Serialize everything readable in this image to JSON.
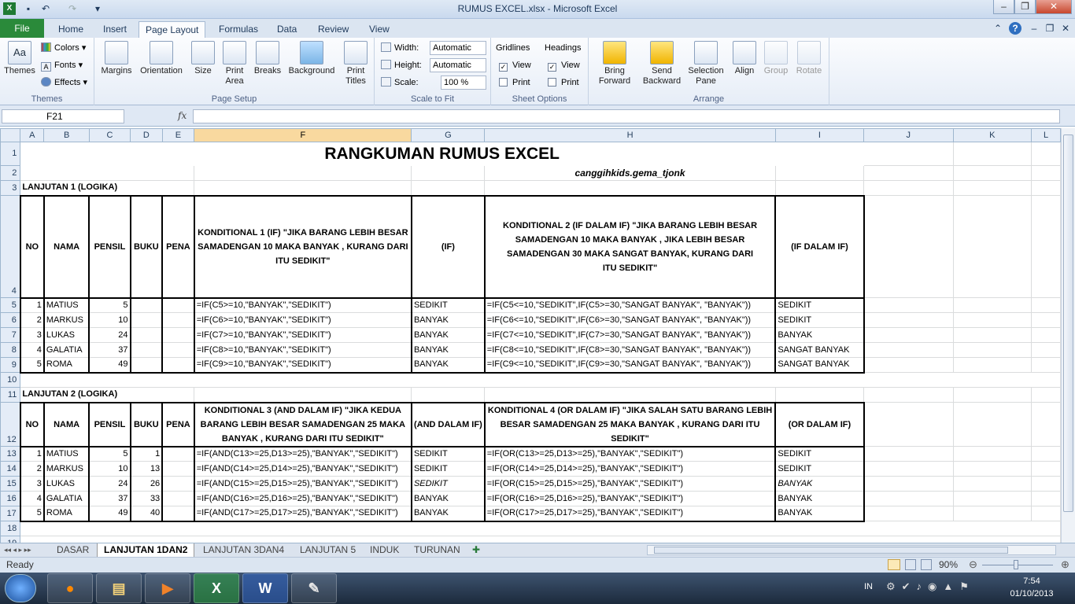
{
  "window": {
    "title": "RUMUS EXCEL.xlsx - Microsoft Excel",
    "controls": [
      "–",
      "❐",
      "✕"
    ]
  },
  "tabs": [
    "File",
    "Home",
    "Insert",
    "Page Layout",
    "Formulas",
    "Data",
    "Review",
    "View"
  ],
  "ribbon": {
    "themes": {
      "themes": "Themes",
      "colors": "Colors",
      "fonts": "Fonts",
      "effects": "Effects",
      "label": "Themes"
    },
    "page_setup": {
      "margins": "Margins",
      "orientation": "Orientation",
      "size": "Size",
      "print_area": "Print Area",
      "breaks": "Breaks",
      "background": "Background",
      "print_titles": "Print Titles",
      "label": "Page Setup"
    },
    "scale": {
      "width_label": "Width:",
      "width_value": "Automatic",
      "height_label": "Height:",
      "height_value": "Automatic",
      "scale_label": "Scale:",
      "scale_value": "100 %",
      "label": "Scale to Fit"
    },
    "sheet_options": {
      "gridlines": "Gridlines",
      "headings": "Headings",
      "view": "View",
      "print": "Print",
      "label": "Sheet Options"
    },
    "arrange": {
      "bring_forward": "Bring Forward",
      "send_backward": "Send Backward",
      "selection_pane": "Selection Pane",
      "align": "Align",
      "group": "Group",
      "rotate": "Rotate",
      "label": "Arrange"
    }
  },
  "formula_bar": {
    "name_box": "F21",
    "fx": "fx",
    "value": ""
  },
  "columns": [
    "A",
    "B",
    "C",
    "D",
    "E",
    "F",
    "G",
    "H",
    "I",
    "J",
    "K",
    "L"
  ],
  "sheet": {
    "title": "RANGKUMAN RUMUS EXCEL",
    "subtitle": "canggihkids.gema_tjonk",
    "section1": "LANJUTAN 1 (LOGIKA)",
    "section2": "LANJUTAN 2 (LOGIKA)",
    "headers1": [
      "NO",
      "NAMA",
      "PENSIL",
      "BUKU",
      "PENA",
      "KONDITIONAL 1 (IF) \"JIKA BARANG LEBIH BESAR SAMADENGAN 10 MAKA BANYAK , KURANG DARI ITU SEDIKIT\"",
      "(IF)",
      "KONDITIONAL 2 (IF DALAM IF) \"JIKA BARANG LEBIH BESAR SAMADENGAN 10 MAKA BANYAK , JIKA LEBIH BESAR SAMADENGAN 30 MAKA SANGAT BANYAK, KURANG DARI ITU SEDIKIT\"",
      "(IF DALAM IF)"
    ],
    "rows1": [
      [
        "1",
        "MATIUS",
        "5",
        "",
        "",
        "=IF(C5>=10,\"BANYAK\",\"SEDIKIT\")",
        "SEDIKIT",
        "=IF(C5<=10,\"SEDIKIT\",IF(C5>=30,\"SANGAT BANYAK\", \"BANYAK\"))",
        "SEDIKIT"
      ],
      [
        "2",
        "MARKUS",
        "10",
        "",
        "",
        "=IF(C6>=10,\"BANYAK\",\"SEDIKIT\")",
        "BANYAK",
        "=IF(C6<=10,\"SEDIKIT\",IF(C6>=30,\"SANGAT BANYAK\", \"BANYAK\"))",
        "SEDIKIT"
      ],
      [
        "3",
        "LUKAS",
        "24",
        "",
        "",
        "=IF(C7>=10,\"BANYAK\",\"SEDIKIT\")",
        "BANYAK",
        "=IF(C7<=10,\"SEDIKIT\",IF(C7>=30,\"SANGAT BANYAK\", \"BANYAK\"))",
        "BANYAK"
      ],
      [
        "4",
        "GALATIA",
        "37",
        "",
        "",
        "=IF(C8>=10,\"BANYAK\",\"SEDIKIT\")",
        "BANYAK",
        "=IF(C8<=10,\"SEDIKIT\",IF(C8>=30,\"SANGAT BANYAK\", \"BANYAK\"))",
        "SANGAT BANYAK"
      ],
      [
        "5",
        "ROMA",
        "49",
        "",
        "",
        "=IF(C9>=10,\"BANYAK\",\"SEDIKIT\")",
        "BANYAK",
        "=IF(C9<=10,\"SEDIKIT\",IF(C9>=30,\"SANGAT BANYAK\", \"BANYAK\"))",
        "SANGAT BANYAK"
      ]
    ],
    "headers2": [
      "NO",
      "NAMA",
      "PENSIL",
      "BUKU",
      "PENA",
      "KONDITIONAL 3 (AND DALAM IF) \"JIKA KEDUA BARANG LEBIH BESAR SAMADENGAN 25 MAKA BANYAK , KURANG DARI ITU SEDIKIT\"",
      "(AND DALAM IF)",
      "KONDITIONAL 4 (OR DALAM IF) \"JIKA SALAH SATU BARANG LEBIH BESAR SAMADENGAN 25 MAKA BANYAK , KURANG DARI ITU SEDIKIT\"",
      "(OR DALAM IF)"
    ],
    "rows2": [
      [
        "1",
        "MATIUS",
        "5",
        "1",
        "",
        "=IF(AND(C13>=25,D13>=25),\"BANYAK\",\"SEDIKIT\")",
        "SEDIKIT",
        "=IF(OR(C13>=25,D13>=25),\"BANYAK\",\"SEDIKIT\")",
        "SEDIKIT"
      ],
      [
        "2",
        "MARKUS",
        "10",
        "13",
        "",
        "=IF(AND(C14>=25,D14>=25),\"BANYAK\",\"SEDIKIT\")",
        "SEDIKIT",
        "=IF(OR(C14>=25,D14>=25),\"BANYAK\",\"SEDIKIT\")",
        "SEDIKIT"
      ],
      [
        "3",
        "LUKAS",
        "24",
        "26",
        "",
        "=IF(AND(C15>=25,D15>=25),\"BANYAK\",\"SEDIKIT\")",
        "SEDIKIT",
        "=IF(OR(C15>=25,D15>=25),\"BANYAK\",\"SEDIKIT\")",
        "BANYAK"
      ],
      [
        "4",
        "GALATIA",
        "37",
        "33",
        "",
        "=IF(AND(C16>=25,D16>=25),\"BANYAK\",\"SEDIKIT\")",
        "BANYAK",
        "=IF(OR(C16>=25,D16>=25),\"BANYAK\",\"SEDIKIT\")",
        "BANYAK"
      ],
      [
        "5",
        "ROMA",
        "49",
        "40",
        "",
        "=IF(AND(C17>=25,D17>=25),\"BANYAK\",\"SEDIKIT\")",
        "BANYAK",
        "=IF(OR(C17>=25,D17>=25),\"BANYAK\",\"SEDIKIT\")",
        "BANYAK"
      ]
    ]
  },
  "sheet_tabs": [
    "DASAR",
    "LANJUTAN 1DAN2",
    "LANJUTAN 3DAN4",
    "LANJUTAN 5",
    "INDUK",
    "TURUNAN"
  ],
  "status": {
    "ready": "Ready",
    "zoom": "90%"
  },
  "taskbar": {
    "lang": "IN",
    "time": "7:54",
    "date": "01/10/2013"
  }
}
